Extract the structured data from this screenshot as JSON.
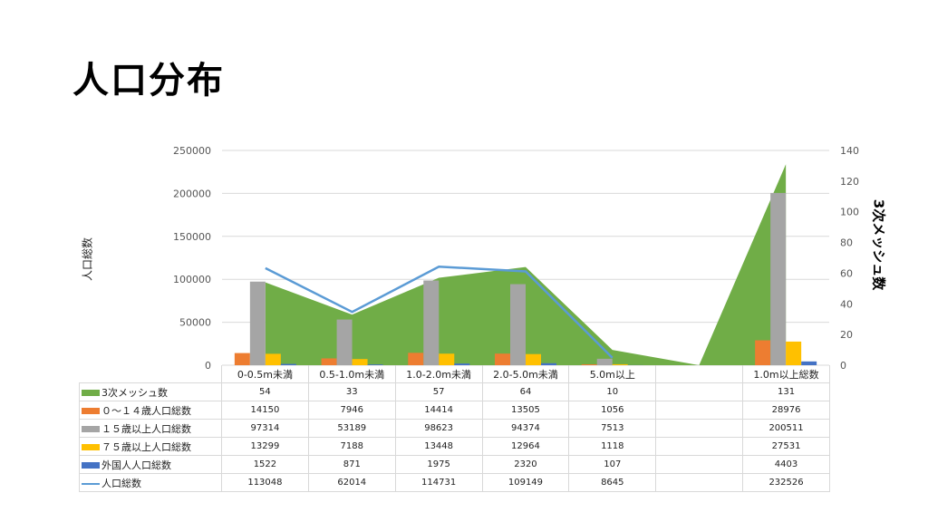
{
  "title": "人口分布",
  "chart_data": {
    "type": "bar",
    "categories": [
      "0-0.5m未満",
      "0.5-1.0m未満",
      "1.0-2.0m未満",
      "2.0-5.0m未満",
      "5.0m以上",
      "",
      "1.0m以上総数"
    ],
    "ylabel": "人口総数",
    "ylabel_right": "3次メッシュ数",
    "ylim": [
      0,
      250000
    ],
    "yticks": [
      "250000",
      "200000",
      "150000",
      "100000",
      "50000",
      "0"
    ],
    "ylim_right": [
      0,
      140
    ],
    "yticks_right": [
      "140",
      "120",
      "100",
      "80",
      "60",
      "40",
      "20",
      "0"
    ],
    "series": [
      {
        "name": "3次メッシュ数",
        "kind": "area",
        "axis": "right",
        "color": "#70ad47",
        "values": [
          54,
          33,
          57,
          64,
          10,
          null,
          131
        ],
        "labels": [
          "54",
          "33",
          "57",
          "64",
          "10",
          "",
          "131"
        ]
      },
      {
        "name": "０～１４歳人口総数",
        "kind": "bar",
        "axis": "left",
        "color": "#ed7d31",
        "values": [
          14150,
          7946,
          14414,
          13505,
          1056,
          null,
          28976
        ],
        "labels": [
          "14150",
          "7946",
          "14414",
          "13505",
          "1056",
          "",
          "28976"
        ]
      },
      {
        "name": "１５歳以上人口総数",
        "kind": "bar",
        "axis": "left",
        "color": "#a5a5a5",
        "values": [
          97314,
          53189,
          98623,
          94374,
          7513,
          null,
          200511
        ],
        "labels": [
          "97314",
          "53189",
          "98623",
          "94374",
          "7513",
          "",
          "200511"
        ]
      },
      {
        "name": "７５歳以上人口総数",
        "kind": "bar",
        "axis": "left",
        "color": "#ffc000",
        "values": [
          13299,
          7188,
          13448,
          12964,
          1118,
          null,
          27531
        ],
        "labels": [
          "13299",
          "7188",
          "13448",
          "12964",
          "1118",
          "",
          "27531"
        ]
      },
      {
        "name": "外国人人口総数",
        "kind": "bar",
        "axis": "left",
        "color": "#4472c4",
        "values": [
          1522,
          871,
          1975,
          2320,
          107,
          null,
          4403
        ],
        "labels": [
          "1522",
          "871",
          "1975",
          "2320",
          "107",
          "",
          "4403"
        ]
      },
      {
        "name": "人口総数",
        "kind": "line",
        "axis": "left",
        "color": "#5b9bd5",
        "values": [
          113048,
          62014,
          114731,
          109149,
          8645,
          null,
          232526
        ],
        "labels": [
          "113048",
          "62014",
          "114731",
          "109149",
          "8645",
          "",
          "232526"
        ]
      }
    ]
  }
}
